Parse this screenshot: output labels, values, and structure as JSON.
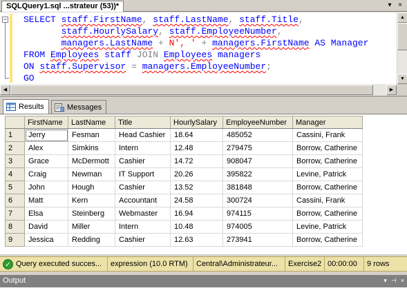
{
  "document_tab": {
    "title": "SQLQuery1.sql ...strateur (53))*"
  },
  "tab_controls": {
    "dropdown": "▾",
    "close": "×"
  },
  "editor": {
    "line1": {
      "kw_select": "SELECT",
      "t1": "staff.FirstName",
      "c1": ",",
      "t2": "staff.LastName",
      "c2": ",",
      "t3": "staff.Title",
      "c3": ","
    },
    "line2": {
      "t1": "staff.HourlySalary",
      "c1": ",",
      "t2": "staff.EmployeeNumber",
      "c2": ","
    },
    "line3": {
      "t1": "managers.LastName",
      "plus1": "+",
      "s1": "N', '",
      "plus2": "+",
      "t2": "managers.FirstName",
      "kw_as": "AS",
      "alias": "Manager"
    },
    "line4": {
      "kw_from": "FROM",
      "t1": "Employees",
      "a1": "staff",
      "kw_join": "JOIN",
      "t2": "Employees",
      "a2": "managers"
    },
    "line5": {
      "kw_on": "ON",
      "t1": "staff.Supervisor",
      "eq": "=",
      "t2": "managers.EmployeeNumber",
      "semi": ";"
    },
    "line6": {
      "kw_go": "GO"
    }
  },
  "results_tabs": {
    "results": "Results",
    "messages": "Messages"
  },
  "grid": {
    "columns": [
      "FirstName",
      "LastName",
      "Title",
      "HourlySalary",
      "EmployeeNumber",
      "Manager"
    ],
    "rows": [
      {
        "n": "1",
        "c": [
          "Jerry",
          "Fesman",
          "Head Cashier",
          "18.64",
          "485052",
          "Cassini, Frank"
        ]
      },
      {
        "n": "2",
        "c": [
          "Alex",
          "Simkins",
          "Intern",
          "12.48",
          "279475",
          "Borrow, Catherine"
        ]
      },
      {
        "n": "3",
        "c": [
          "Grace",
          "McDermott",
          "Cashier",
          "14.72",
          "908047",
          "Borrow, Catherine"
        ]
      },
      {
        "n": "4",
        "c": [
          "Craig",
          "Newman",
          "IT Support",
          "20.26",
          "395822",
          "Levine, Patrick"
        ]
      },
      {
        "n": "5",
        "c": [
          "John",
          "Hough",
          "Cashier",
          "13.52",
          "381848",
          "Borrow, Catherine"
        ]
      },
      {
        "n": "6",
        "c": [
          "Matt",
          "Kern",
          "Accountant",
          "24.58",
          "300724",
          "Cassini, Frank"
        ]
      },
      {
        "n": "7",
        "c": [
          "Elsa",
          "Steinberg",
          "Webmaster",
          "16.94",
          "974115",
          "Borrow, Catherine"
        ]
      },
      {
        "n": "8",
        "c": [
          "David",
          "Miller",
          "Intern",
          "10.48",
          "974005",
          "Levine, Patrick"
        ]
      },
      {
        "n": "9",
        "c": [
          "Jessica",
          "Redding",
          "Cashier",
          "12.63",
          "273941",
          "Borrow, Catherine"
        ]
      }
    ]
  },
  "status": {
    "message": "Query executed succes...",
    "server": "expression (10.0 RTM)",
    "user": "Central\\Administrateur...",
    "database": "Exercise2",
    "elapsed": "00:00:00",
    "rows": "9 rows"
  },
  "output": {
    "title": "Output",
    "controls": {
      "dropdown": "▾",
      "pin": "⊣",
      "close": "×"
    }
  },
  "colors": {
    "keyword": "#0000ff",
    "string": "#ff0000",
    "operator": "#808080",
    "status_bar": "#ece2a8",
    "success": "#2e9e2e"
  }
}
